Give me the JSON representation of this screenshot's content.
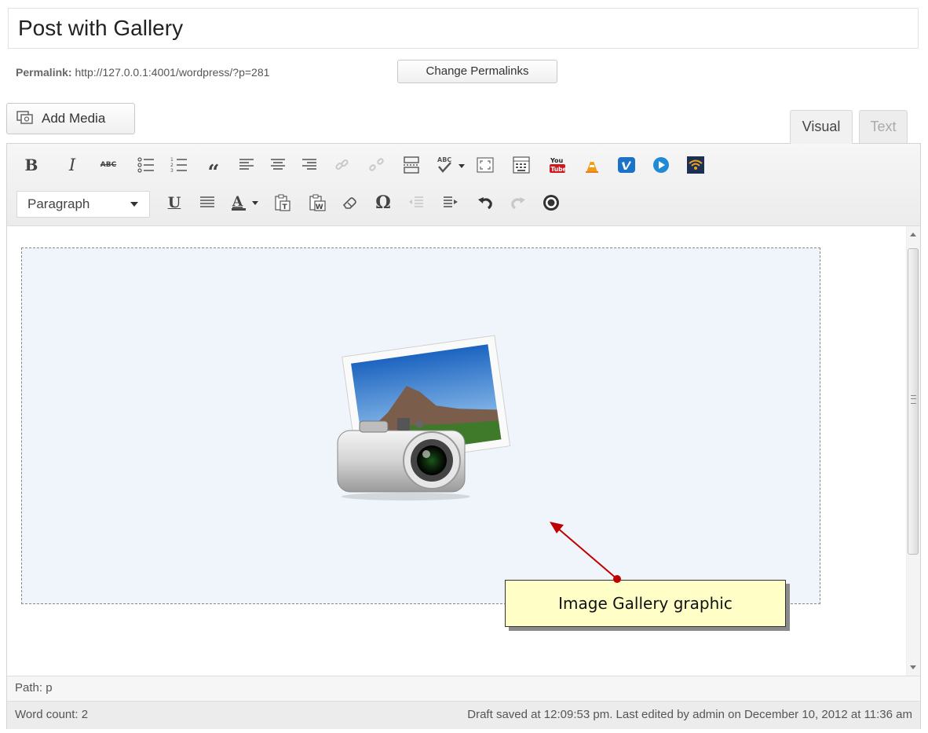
{
  "post": {
    "title": "Post with Gallery"
  },
  "permalink": {
    "label": "Permalink:",
    "url": "http://127.0.0.1:4001/wordpress/?p=281",
    "change_button": "Change Permalinks"
  },
  "media": {
    "add_media_label": "Add Media"
  },
  "editor_tabs": {
    "visual": "Visual",
    "text": "Text",
    "active": "Visual"
  },
  "toolbar": {
    "row1_icons": [
      "bold-icon",
      "italic-icon",
      "strikethrough-icon",
      "bullet-list-icon",
      "numbered-list-icon",
      "blockquote-icon",
      "align-left-icon",
      "align-center-icon",
      "align-right-icon",
      "insert-link-icon",
      "remove-link-icon",
      "insert-more-icon",
      "spellcheck-icon",
      "fullscreen-icon",
      "kitchen-sink-icon",
      "youtube-icon",
      "vlc-icon",
      "vimeo-icon",
      "media-play-icon",
      "wifi-icon"
    ],
    "row2_icons": [
      "underline-icon",
      "justify-icon",
      "text-color-icon",
      "paste-text-icon",
      "paste-word-icon",
      "clear-formatting-icon",
      "special-character-icon",
      "outdent-icon",
      "indent-icon",
      "undo-icon",
      "redo-icon",
      "help-icon"
    ],
    "format_select": "Paragraph",
    "bold_glyph": "B",
    "italic_glyph": "I",
    "underline_glyph": "U",
    "text_color_glyph": "A",
    "omega_glyph": "Ω",
    "quote_glyph": "“",
    "abc_glyph": "ABC",
    "youtube_top": "You",
    "youtube_bottom": "Tube"
  },
  "status": {
    "path_label": "Path: p",
    "word_count": "Word count: 2",
    "draft_info": "Draft saved at 12:09:53 pm. Last edited by admin on December 10, 2012 at 11:36 am"
  },
  "annotation": {
    "callout_text": "Image Gallery graphic"
  },
  "colors": {
    "gallery_bg": "#f0f5fc",
    "callout_bg": "#fffec6",
    "arrow": "#c00000"
  }
}
